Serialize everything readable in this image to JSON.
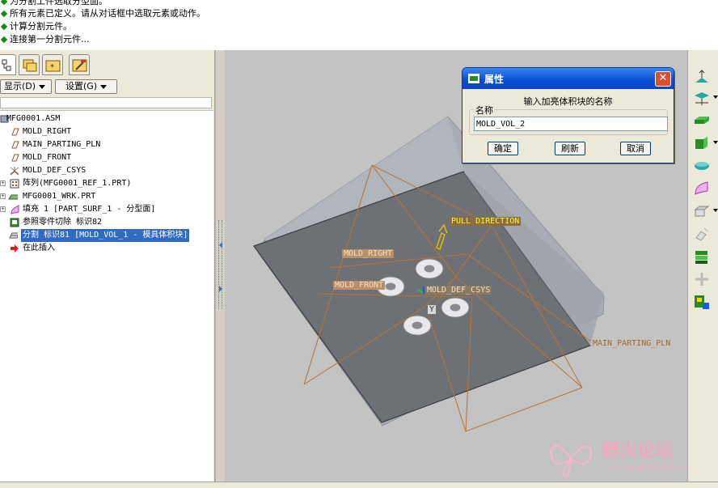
{
  "messages": [
    "为分割工件选取分型面。",
    "所有元素已定义。请从对话框中选取元素或动作。",
    "计算分割元件。",
    "连接第一分割元件..."
  ],
  "left_panel": {
    "show_menu": "显示(D)",
    "settings_menu": "设置(G)"
  },
  "tree": [
    {
      "label": "MFG0001.ASM",
      "icon": "assembly-icon"
    },
    {
      "label": "MOLD_RIGHT",
      "icon": "datum-plane-icon"
    },
    {
      "label": "MAIN_PARTING_PLN",
      "icon": "datum-plane-icon"
    },
    {
      "label": "MOLD_FRONT",
      "icon": "datum-plane-icon"
    },
    {
      "label": "MOLD_DEF_CSYS",
      "icon": "csys-icon"
    },
    {
      "label": "阵列(MFG0001_REF_1.PRT)",
      "icon": "pattern-icon"
    },
    {
      "label": "MFG0001_WRK.PRT",
      "icon": "part-icon"
    },
    {
      "label": "填充 1 [PART_SURF_1 - 分型面]",
      "icon": "fill-surface-icon"
    },
    {
      "label": "参照零件切除 标识82",
      "icon": "cutout-icon"
    },
    {
      "label": "分割 标识81 [MOLD_VOL_1 - 模具体积块]",
      "icon": "split-icon"
    },
    {
      "label": "在此插入",
      "icon": "insert-here-icon"
    }
  ],
  "viewport_labels": {
    "pull_direction": "PULL DIRECTION",
    "mold_right": "MOLD_RIGHT",
    "mold_front": "MOLD_FRONT",
    "mold_def_csys": "MOLD_DEF_CSYS",
    "main_parting_pln": "MAIN_PARTING_PLN",
    "axis_y": "Y"
  },
  "dialog": {
    "title": "属性",
    "prompt": "输入加亮体积块的名称",
    "group_label": "名称",
    "name_value": "MOLD_VOL_2",
    "ok_label": "确定",
    "refresh_label": "刷新",
    "cancel_label": "取消"
  },
  "watermark": {
    "title": "野火论坛",
    "url": "www.proewildfire.cn"
  },
  "colors": {
    "selection": "#316ac5",
    "titlebar": "#0a4fd6",
    "datum": "#b87333",
    "label_yellow": "#ffff00"
  }
}
